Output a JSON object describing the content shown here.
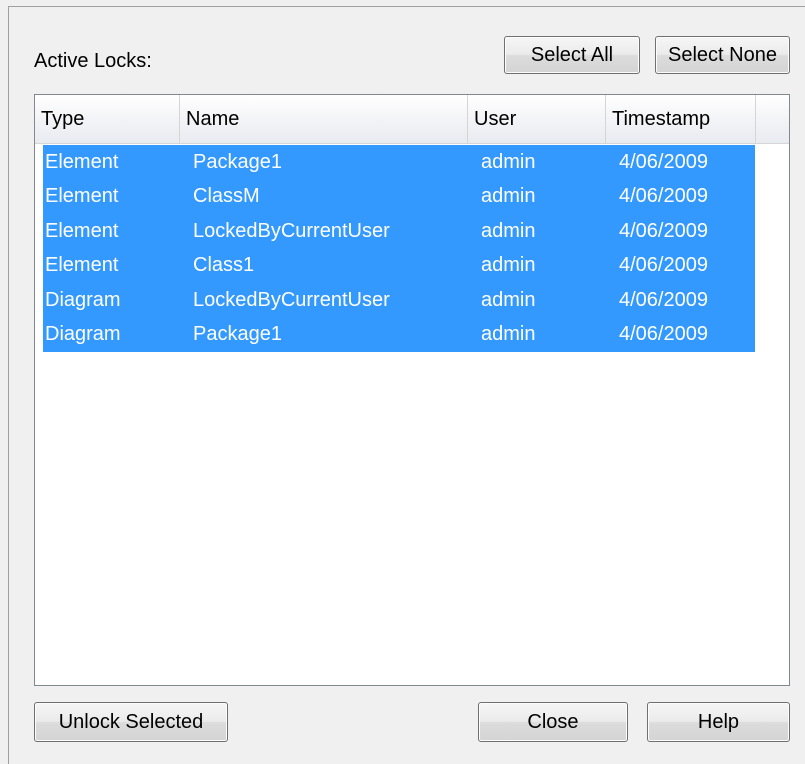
{
  "dialog": {
    "active_locks_label": "Active Locks:",
    "select_all_label": "Select All",
    "select_none_label": "Select None",
    "unlock_selected_label": "Unlock Selected",
    "close_label": "Close",
    "help_label": "Help"
  },
  "table": {
    "columns": [
      "Type",
      "Name",
      "User",
      "Timestamp"
    ],
    "rows": [
      {
        "type": "Element",
        "name": "Package1",
        "user": "admin",
        "timestamp": "4/06/2009"
      },
      {
        "type": "Element",
        "name": "ClassM",
        "user": "admin",
        "timestamp": "4/06/2009"
      },
      {
        "type": "Element",
        "name": "LockedByCurrentUser",
        "user": "admin",
        "timestamp": "4/06/2009"
      },
      {
        "type": "Element",
        "name": "Class1",
        "user": "admin",
        "timestamp": "4/06/2009"
      },
      {
        "type": "Diagram",
        "name": "LockedByCurrentUser",
        "user": "admin",
        "timestamp": "4/06/2009"
      },
      {
        "type": "Diagram",
        "name": "Package1",
        "user": "admin",
        "timestamp": "4/06/2009"
      }
    ],
    "selection_color": "#3399ff"
  }
}
